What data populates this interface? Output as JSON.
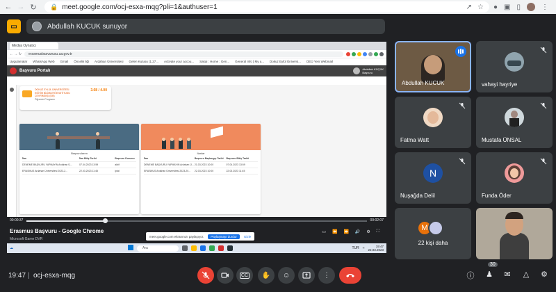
{
  "browser": {
    "url": "meet.google.com/ocj-esxa-mqg?pli=1&authuser=1"
  },
  "presenting": {
    "text": "Abdullah KUCUK sunuyor"
  },
  "shared_screen": {
    "inner_tab": "Medya Oynatıcı",
    "inner_url": "erasmusbasvurusu.ua.gov.tr",
    "bookmarks": [
      "Uygulamalar",
      "WhatsApp Web",
      "Gmail",
      "Öncelik liği",
      "Ardahan Üniversitesi",
      "Gelen Kutusu (1.27...",
      "Activate your accou...",
      "Sakai : Home : Gen...",
      "General Info | My u...",
      "Dokuz Eylül Üniversi...",
      "DEÜ Yeni Webmail"
    ],
    "portal_title": "Başvuru Portalı",
    "portal_user": "Abdullah KÜÇÜK",
    "portal_user_role": "Başvuru",
    "uni_card": {
      "lines": [
        "DOKUZ EYLÜL ÜNİVERSİTESİ",
        "EĞİTİM BİLİMLERİ ENSTİTÜSÜ",
        "ÇEVRİMDIŞI (DB)"
      ],
      "sub": "Öğrenim Programı",
      "score": "3.08 / 4.00"
    },
    "card_blue": {
      "title": "Başvurularım",
      "headers": [
        "İlan",
        "İlan Bitiş Tarihi",
        "Başvuru Durumu"
      ],
      "rows": [
        [
          "DENEME BAŞVURU YAPMAYIN Ardahan Ü...",
          "07.04.2023 13:59",
          "aktif"
        ],
        [
          "ERASMUS Ardahan Üniversitesi 2023-2...",
          "22.03.2023 11:45",
          "iptal"
        ]
      ]
    },
    "card_orange": {
      "title": "İlanlar",
      "headers": [
        "İlan",
        "Başvuru Başlangıç Tarihi",
        "Başvuru Bitiş Tarihi"
      ],
      "rows": [
        [
          "DENEME BAŞVURU YAPMAYIN Ardahan Ü...",
          "21.03.2023 10:00",
          "07.04.2023 13:59"
        ],
        [
          "ERASMUS Ardahan Üniversitesi 2023-20...",
          "22.03.2023 10:00",
          "22.03.2023 11:45"
        ]
      ]
    },
    "player": {
      "time_left": "00:00:37",
      "time_right": "00:02:07",
      "progress_fraction": 0.23,
      "title": "Erasmus Başvuru - Google Chrome",
      "subtitle": "Microsoft Game DVR"
    },
    "share_banner": {
      "text": "meet.google.com ekranınızı paylaşıyor.",
      "stop": "Paylaşmayı durdur",
      "hide": "Gizle"
    },
    "taskbar": {
      "search": "Ara",
      "lang": "TUR",
      "clock_time": "19:47",
      "clock_date": "22.03.2023"
    }
  },
  "participants": [
    {
      "name": "Abdullah KUCUK",
      "speaking": true
    },
    {
      "name": "vahayi hayriye",
      "muted": true
    },
    {
      "name": "Fatma Watt",
      "muted": true
    },
    {
      "name": "Mustafa ÜNSAL",
      "muted": true
    },
    {
      "name": "Nuşağda Delil",
      "muted": true,
      "letter": "N"
    },
    {
      "name": "Funda Öder",
      "muted": true
    },
    {
      "name": "22 kişi daha",
      "letter": "M"
    },
    {
      "name": ""
    }
  ],
  "bottom": {
    "time": "19:47",
    "divider": "|",
    "meeting_code": "ocj-esxa-mqg",
    "people_count": "30"
  },
  "colors": {
    "end_call": "#ea4335",
    "present_icon": "#f9ab00",
    "active_border": "#8ab4f8"
  }
}
